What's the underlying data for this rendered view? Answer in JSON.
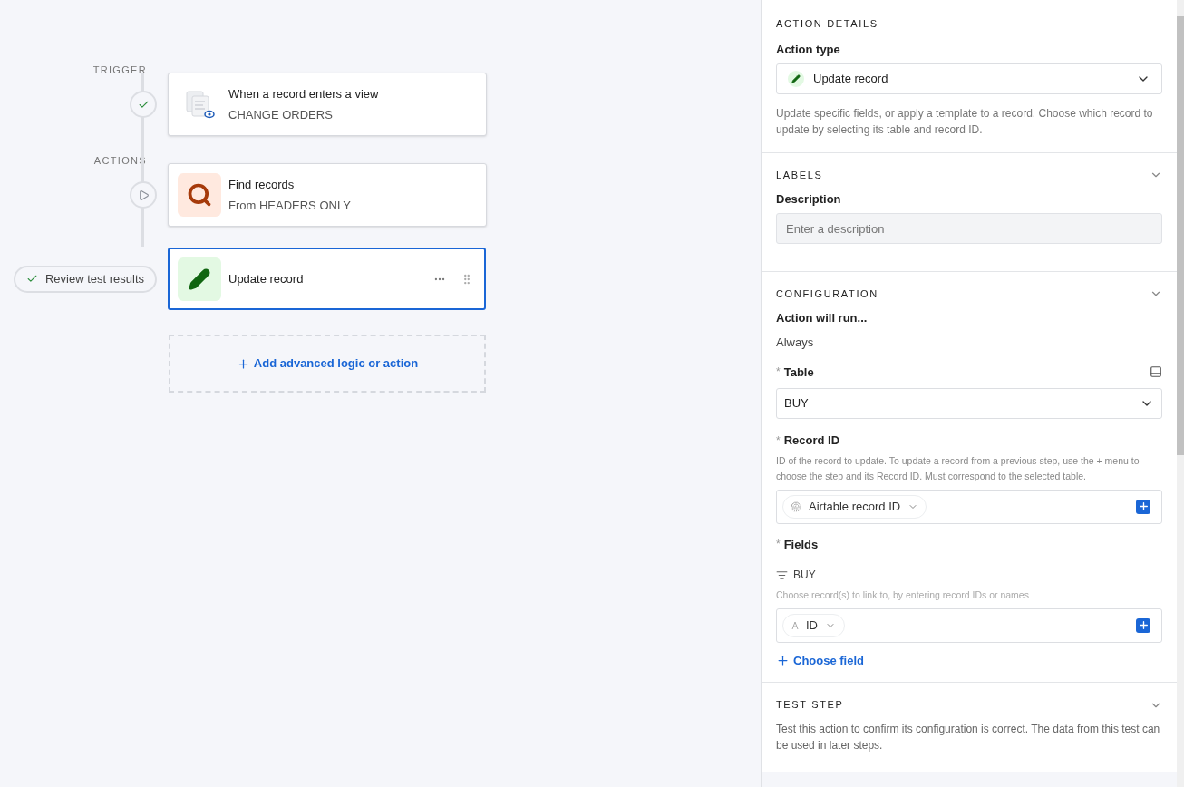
{
  "flow": {
    "groups": [
      {
        "label": "TRIGGER",
        "steps": [
          {
            "kind": "trigger",
            "marker": {
              "kind": "check"
            },
            "title": "When a record enters a view",
            "subtitle": "CHANGE ORDERS",
            "selected": false
          }
        ]
      },
      {
        "label": "ACTIONS",
        "steps": [
          {
            "kind": "find",
            "marker": {
              "kind": "play"
            },
            "title": "Find records",
            "subtitle": "From HEADERS ONLY",
            "selected": false
          },
          {
            "kind": "update",
            "marker": {
              "kind": "pill"
            },
            "review_label": "Review test results",
            "title": "Update record",
            "selected": true
          }
        ]
      }
    ],
    "add_label": "Add advanced logic or action"
  },
  "panel": {
    "action_details": {
      "heading": "ACTION DETAILS",
      "type_label": "Action type",
      "type_value": "Update record",
      "description": "Update specific fields, or apply a template to a record. Choose which record to update by selecting its table and record ID."
    },
    "labels": {
      "heading": "LABELS",
      "description_label": "Description",
      "description_placeholder": "Enter a description"
    },
    "configuration": {
      "heading": "CONFIGURATION",
      "run_label": "Action will run...",
      "run_value": "Always",
      "required_mark": "*",
      "table_label": "Table",
      "table_value": "BUY",
      "record_id_label": "Record ID",
      "record_id_help": "ID of the record to update. To update a record from a previous step, use the + menu to choose the step and its Record ID. Must correspond to the selected table.",
      "record_id_token": "Airtable record ID",
      "fields_label": "Fields",
      "field_name": "BUY",
      "field_help": "Choose record(s) to link to, by entering record IDs or names",
      "field_token": "ID",
      "choose_field": "Choose field"
    },
    "test_step": {
      "heading": "TEST STEP",
      "description": "Test this action to confirm its configuration is correct. The data from this test can be used in later steps."
    }
  }
}
